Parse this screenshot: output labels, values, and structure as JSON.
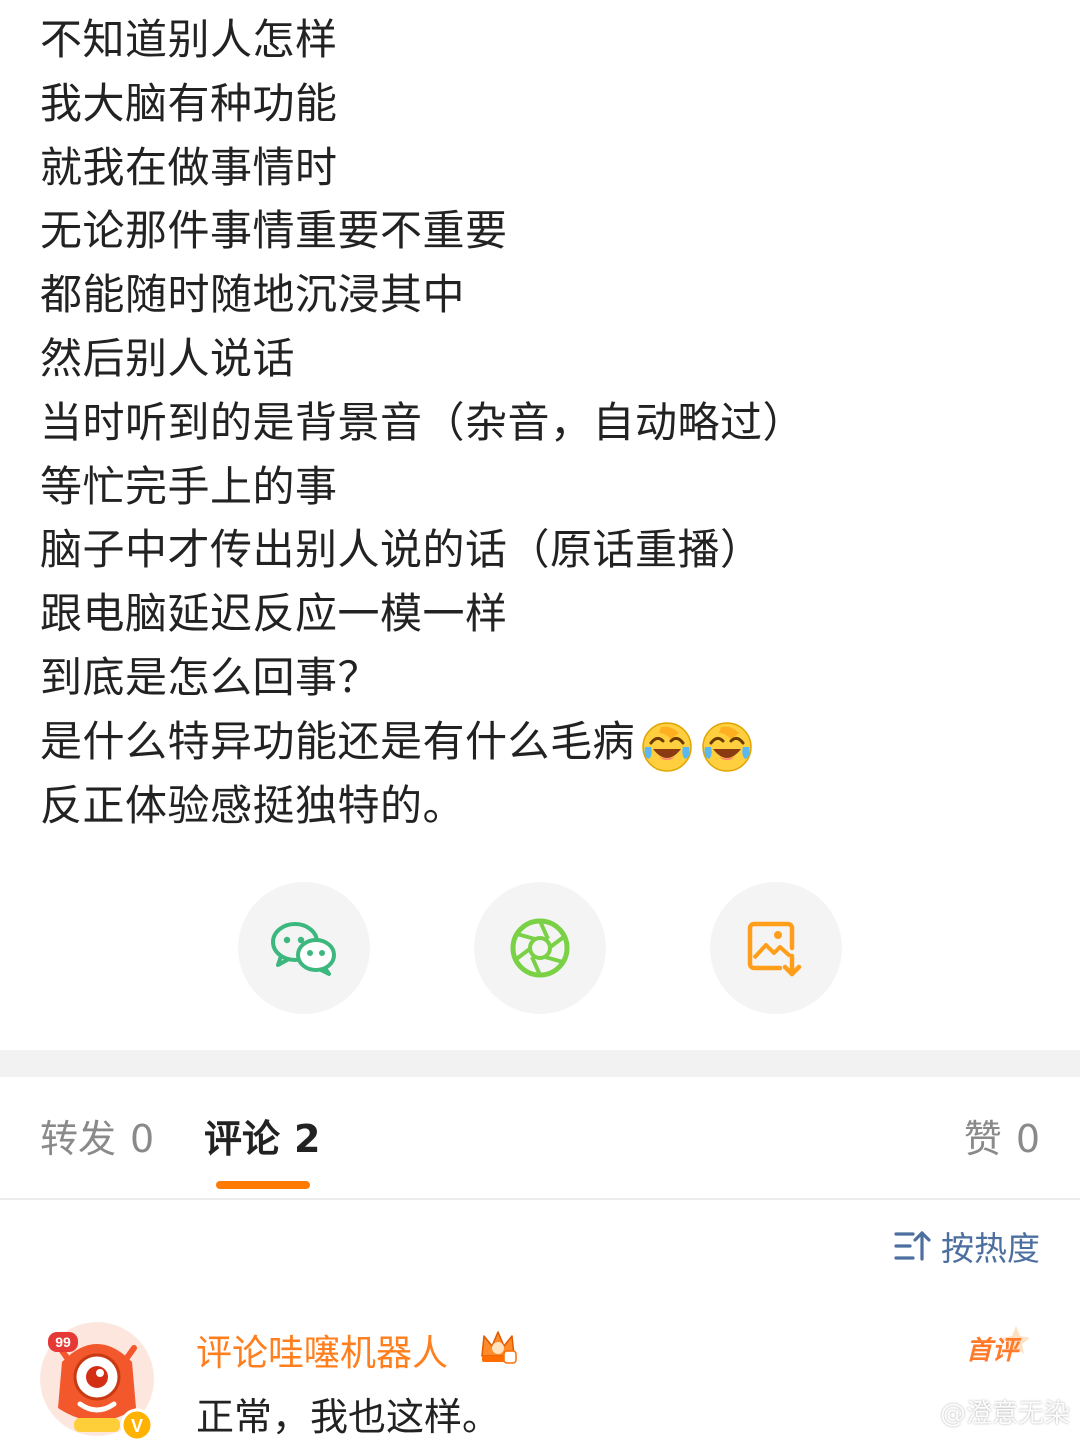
{
  "post": {
    "lines": [
      "不知道别人怎样",
      "我大脑有种功能",
      "就我在做事情时",
      "无论那件事情重要不重要",
      "都能随时随地沉浸其中",
      "然后别人说话",
      "当时听到的是背景音（杂音，自动略过）",
      "等忙完手上的事",
      "脑子中才传出别人说的话（原话重播）",
      "跟电脑延迟反应一模一样",
      "到底是怎么回事？",
      "是什么特异功能还是有什么毛病",
      "反正体验感挺独特的。"
    ],
    "emoji": [
      "laugh-cry-icon",
      "laugh-cry-icon"
    ]
  },
  "share": {
    "wechat_icon": "wechat-icon",
    "moments_icon": "moments-aperture-icon",
    "save_icon": "save-image-icon",
    "colors": {
      "wechat": "#3cb87e",
      "moments": "#7bd146",
      "save": "#ff9e1b"
    }
  },
  "tabs": {
    "repost": {
      "label": "转发",
      "count": "0"
    },
    "comment": {
      "label": "评论",
      "count": "2"
    },
    "like": {
      "label": "赞",
      "count": "0"
    },
    "accent": "#ff7a00"
  },
  "sort": {
    "label": "按热度",
    "icon": "sort-icon"
  },
  "comment": {
    "author": "评论哇噻机器人",
    "text": "正常，我也这样。",
    "badge": "首评",
    "avatar_level": "99",
    "verified": "V"
  },
  "watermark": "@澄意无染"
}
